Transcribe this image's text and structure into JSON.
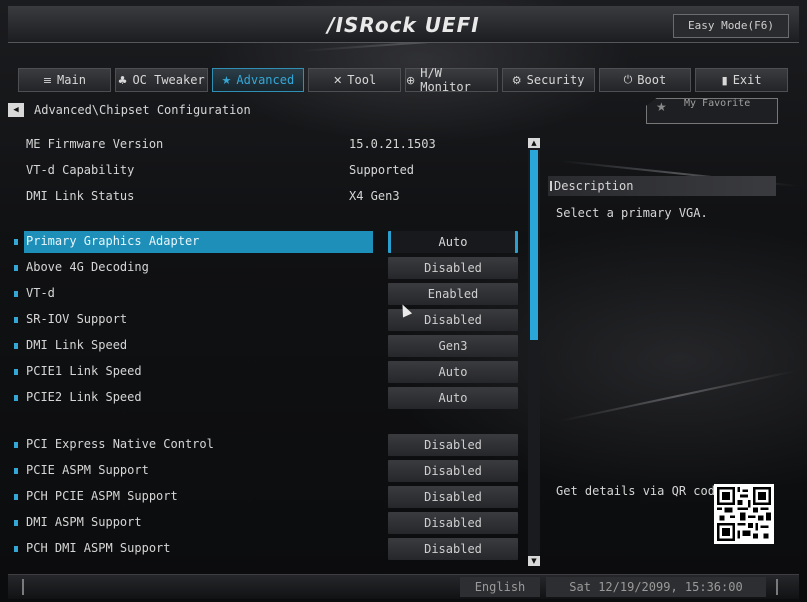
{
  "header": {
    "logo": "/ISRock UEFI",
    "easy_mode": "Easy Mode(F6)"
  },
  "tabs": [
    {
      "label": "Main",
      "icon": "≡"
    },
    {
      "label": "OC Tweaker",
      "icon": "♣"
    },
    {
      "label": "Advanced",
      "icon": "★"
    },
    {
      "label": "Tool",
      "icon": "✕"
    },
    {
      "label": "H/W Monitor",
      "icon": "⊕"
    },
    {
      "label": "Security",
      "icon": "⚙"
    },
    {
      "label": "Boot",
      "icon": "⏻"
    },
    {
      "label": "Exit",
      "icon": "▮"
    }
  ],
  "breadcrumb": {
    "back": "◀",
    "path": "Advanced\\Chipset Configuration"
  },
  "favorite": {
    "label": "My Favorite",
    "star": "★"
  },
  "info": [
    {
      "label": "ME Firmware Version",
      "value": "15.0.21.1503"
    },
    {
      "label": "VT-d Capability",
      "value": "Supported"
    },
    {
      "label": "DMI Link Status",
      "value": "X4  Gen3"
    }
  ],
  "settings": [
    {
      "label": "Primary Graphics Adapter",
      "value": "Auto"
    },
    {
      "label": "Above 4G Decoding",
      "value": "Disabled"
    },
    {
      "label": "VT-d",
      "value": "Enabled"
    },
    {
      "label": "SR-IOV Support",
      "value": "Disabled"
    },
    {
      "label": "DMI Link Speed",
      "value": "Gen3"
    },
    {
      "label": "PCIE1 Link Speed",
      "value": "Auto"
    },
    {
      "label": "PCIE2 Link Speed",
      "value": "Auto"
    },
    {
      "label": "PCI Express Native Control",
      "value": "Disabled"
    },
    {
      "label": "PCIE ASPM Support",
      "value": "Disabled"
    },
    {
      "label": "PCH PCIE ASPM Support",
      "value": "Disabled"
    },
    {
      "label": "DMI ASPM Support",
      "value": "Disabled"
    },
    {
      "label": "PCH DMI ASPM Support",
      "value": "Disabled"
    }
  ],
  "description": {
    "title": "Description",
    "text": "Select a primary VGA.",
    "qr_text": "Get details via QR code"
  },
  "footer": {
    "language": "English",
    "datetime": "Sat 12/19/2099, 15:36:00"
  },
  "scrollbar": {
    "up": "▲",
    "down": "▼"
  }
}
